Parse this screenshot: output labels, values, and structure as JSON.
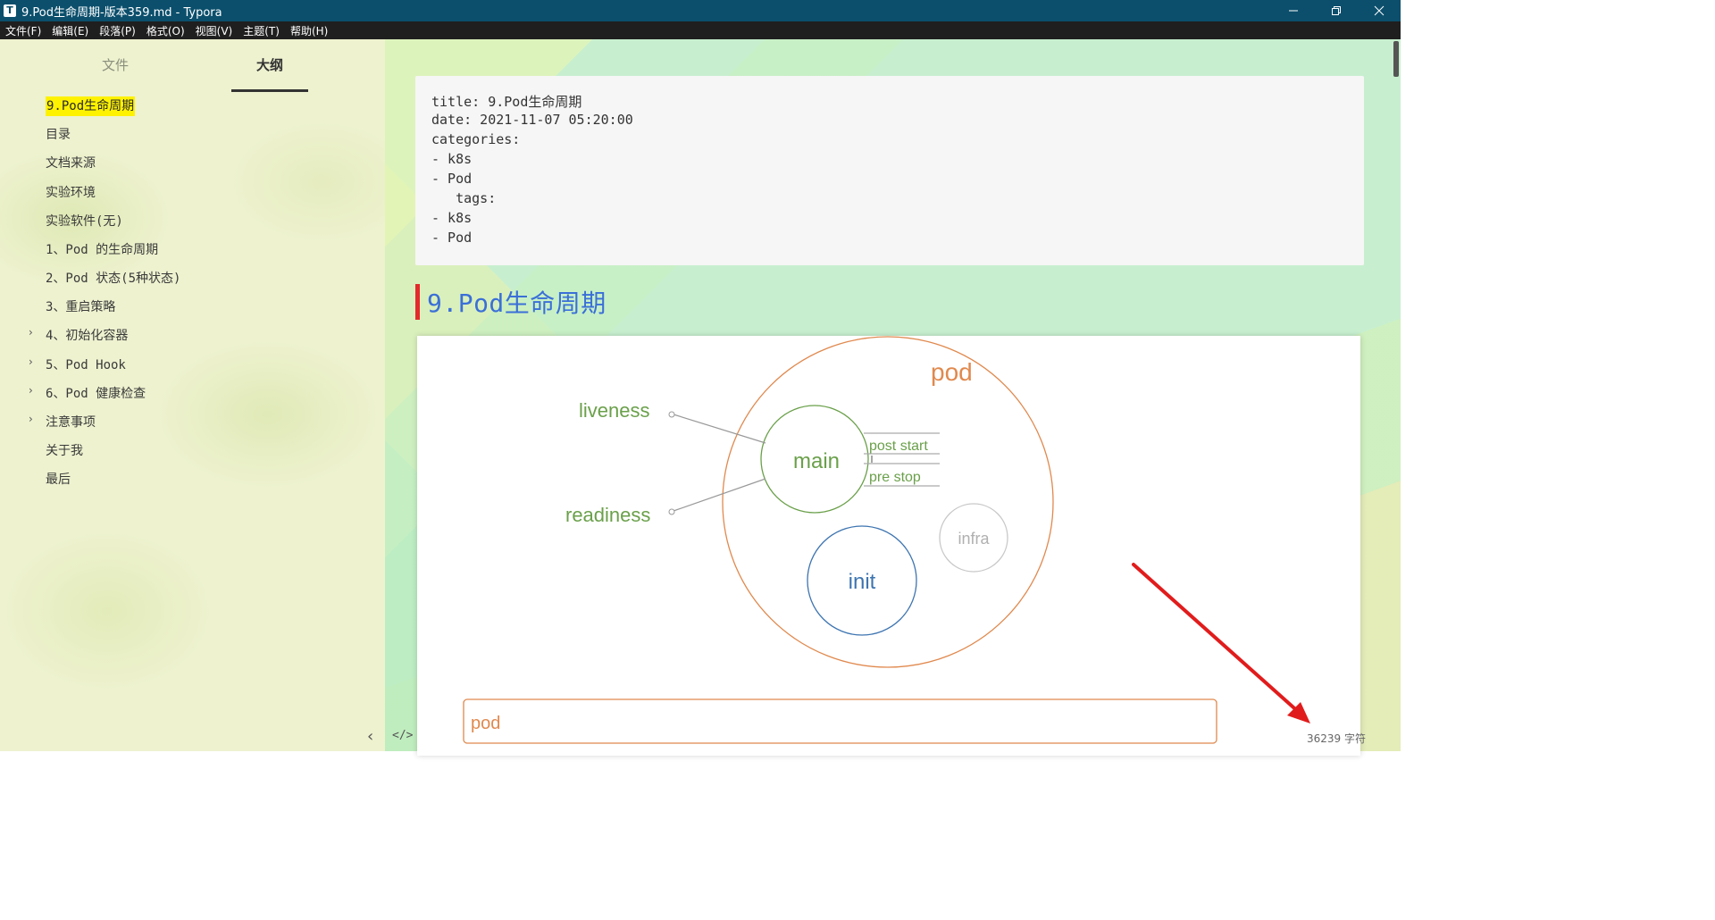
{
  "window": {
    "icon_letter": "T",
    "title": "9.Pod生命周期-版本359.md - Typora"
  },
  "menu": [
    "文件(F)",
    "编辑(E)",
    "段落(P)",
    "格式(O)",
    "视图(V)",
    "主题(T)",
    "帮助(H)"
  ],
  "sidebar": {
    "tabs": [
      {
        "label": "文件",
        "active": false
      },
      {
        "label": "大纲",
        "active": true
      }
    ],
    "outline": [
      {
        "label": "9.Pod生命周期",
        "active": true,
        "expandable": false
      },
      {
        "label": "目录",
        "active": false,
        "expandable": false
      },
      {
        "label": "文档来源",
        "active": false,
        "expandable": false
      },
      {
        "label": "实验环境",
        "active": false,
        "expandable": false
      },
      {
        "label": "实验软件(无)",
        "active": false,
        "expandable": false
      },
      {
        "label": "1、Pod 的生命周期",
        "active": false,
        "expandable": false
      },
      {
        "label": "2、Pod 状态(5种状态)",
        "active": false,
        "expandable": false
      },
      {
        "label": "3、重启策略",
        "active": false,
        "expandable": false
      },
      {
        "label": "4、初始化容器",
        "active": false,
        "expandable": true
      },
      {
        "label": "5、Pod Hook",
        "active": false,
        "expandable": true
      },
      {
        "label": "6、Pod 健康检查",
        "active": false,
        "expandable": true
      },
      {
        "label": "注意事项",
        "active": false,
        "expandable": true
      },
      {
        "label": "关于我",
        "active": false,
        "expandable": false
      },
      {
        "label": "最后",
        "active": false,
        "expandable": false
      }
    ]
  },
  "document": {
    "front_matter": [
      "title: 9.Pod生命周期",
      "date: 2021-11-07 05:20:00",
      "categories:",
      "- k8s",
      "- Pod",
      "   tags:",
      "- k8s",
      "- Pod"
    ],
    "heading": "9.Pod生命周期",
    "diagram": {
      "pod_label": "pod",
      "liveness_label": "liveness",
      "readiness_label": "readiness",
      "main_label": "main",
      "post_start_label": "post start",
      "pre_stop_label": "pre stop",
      "infra_label": "infra",
      "init_label": "init",
      "timeline_label": "pod"
    }
  },
  "status": {
    "word_count": "36239 字符",
    "source_toggle": "</>",
    "collapse": "‹"
  },
  "colors": {
    "titlebar": "#0b4f6c",
    "heading_text": "#3a6fd8",
    "heading_bar": "#e32b2b",
    "pod_orange": "#e0894e",
    "main_green": "#6aa04a",
    "init_blue": "#3d74b0",
    "infra_gray": "#b8b8b8",
    "highlight": "#fff200",
    "arrow_red": "#e11c1c"
  }
}
